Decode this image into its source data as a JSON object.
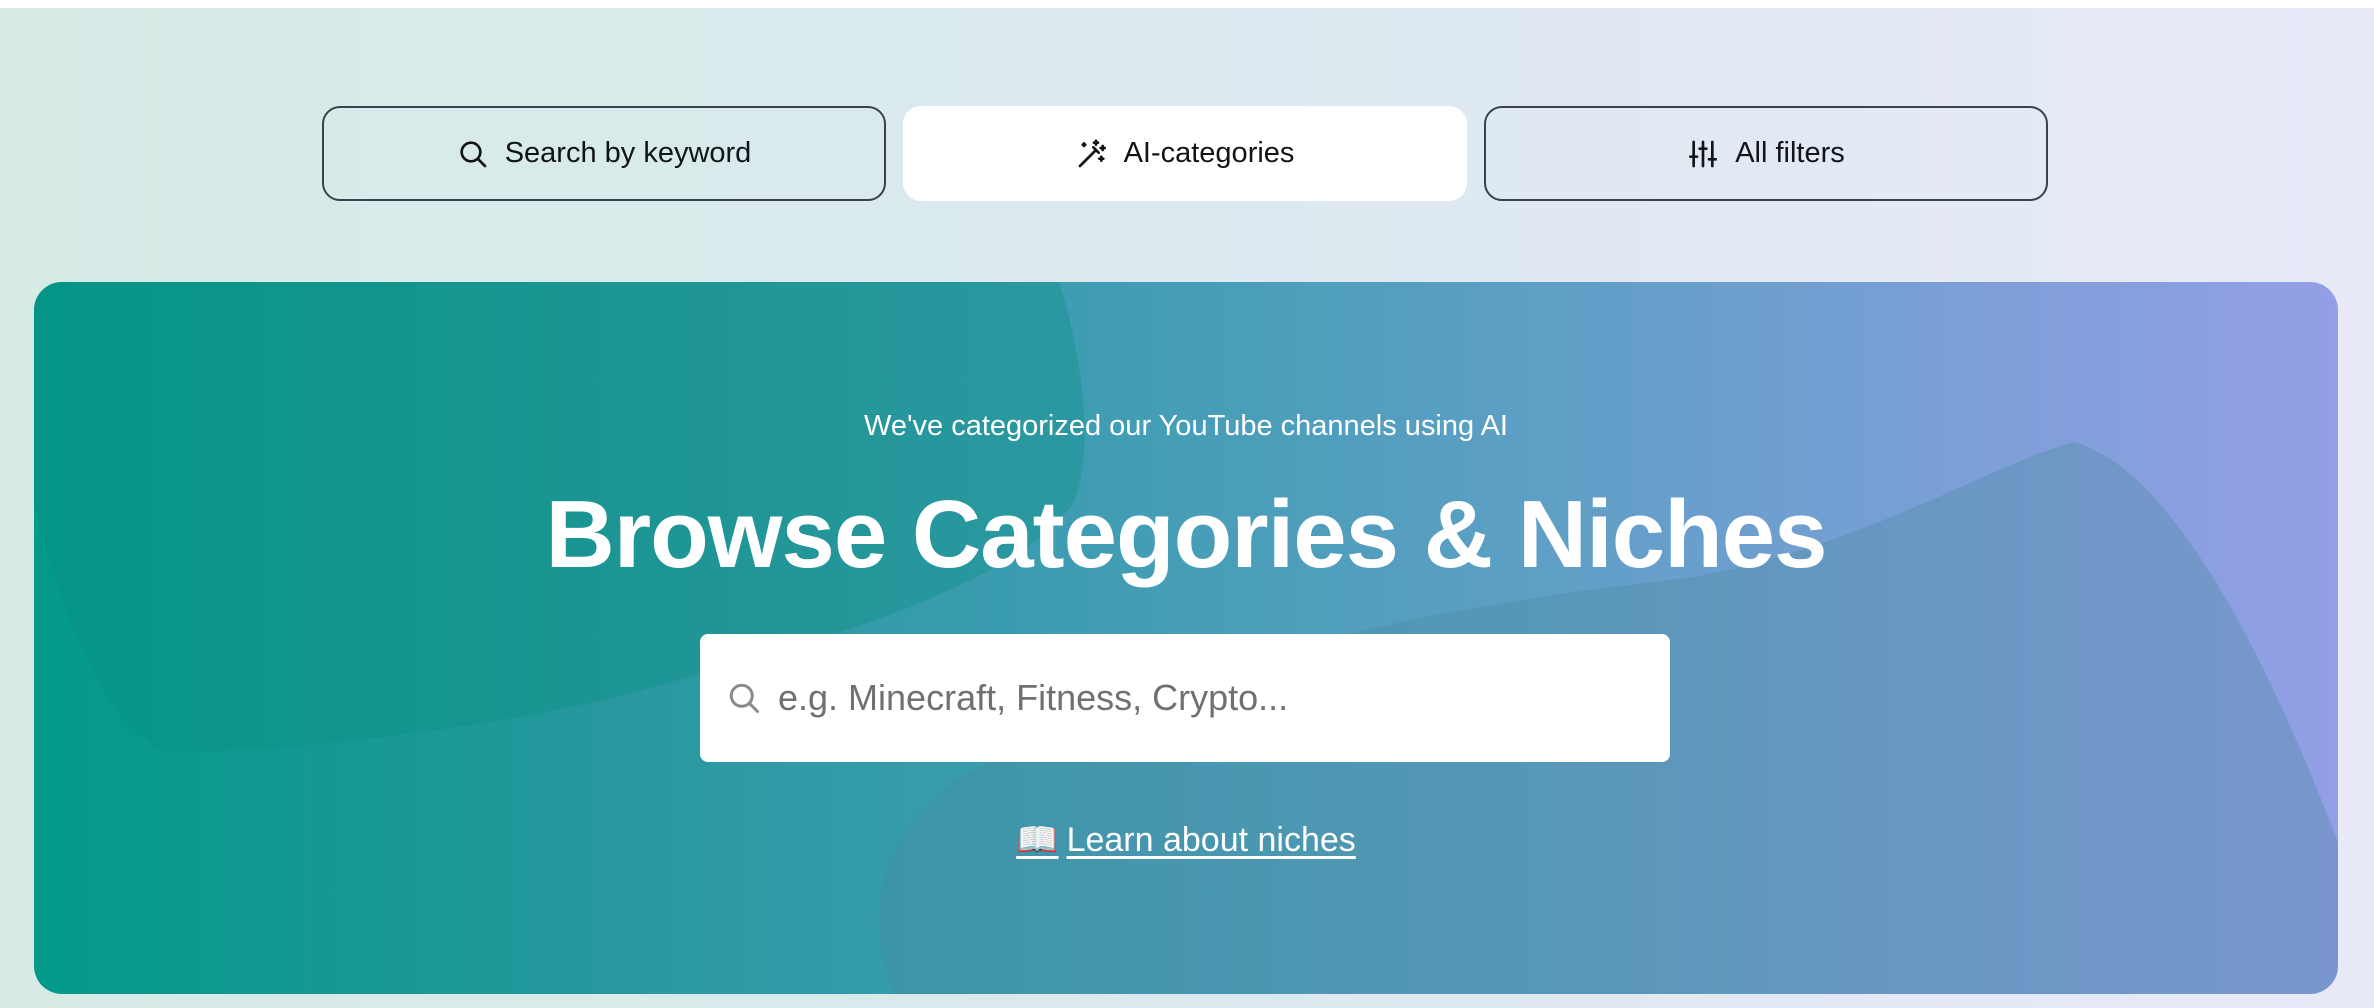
{
  "tabs": [
    {
      "label": "Search by keyword",
      "icon": "search-icon",
      "active": false
    },
    {
      "label": "AI-categories",
      "icon": "magic-wand-icon",
      "active": true
    },
    {
      "label": "All filters",
      "icon": "sliders-icon",
      "active": false
    }
  ],
  "hero": {
    "subtitle": "We've categorized our YouTube channels using AI",
    "title": "Browse Categories & Niches",
    "search": {
      "placeholder": "e.g. Minecraft, Fitness, Crypto...",
      "value": ""
    },
    "learn_link": {
      "emoji": "📖",
      "label": "Learn about niches"
    }
  },
  "colors": {
    "hero_start": "#02998a",
    "hero_end": "#939fe6",
    "page_bg": "#d6ebe6"
  }
}
